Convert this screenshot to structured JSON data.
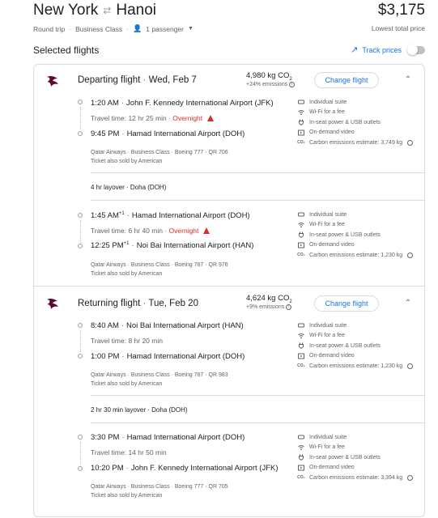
{
  "header": {
    "origin": "New York",
    "swap_icon": "swap-arrows-icon",
    "destination": "Hanoi",
    "total_price": "$3,175",
    "trip_type": "Round trip",
    "cabin": "Business Class",
    "passengers": "1 passenger",
    "price_note": "Lowest total price"
  },
  "selected": {
    "title": "Selected flights",
    "track_label": "Track prices",
    "track_enabled": false
  },
  "departing": {
    "heading": "Departing flight",
    "date": "Wed, Feb 7",
    "co2_value": "4,980 kg CO",
    "co2_sub": "2",
    "co2_note": "+24% emissions",
    "change_label": "Change flight",
    "legs": [
      {
        "dep_time": "1:20 AM",
        "dep_sup": "",
        "dep_airport": "John F. Kennedy International Airport (JFK)",
        "travel_time": "Travel time: 12 hr 25 min",
        "overnight": "Overnight",
        "arr_time": "9:45 PM",
        "arr_sup": "",
        "arr_airport": "Hamad International Airport (DOH)",
        "details": "Qatar Airways · Business Class · Boeing 777 · QR 706",
        "sold_by": "Ticket also sold by American",
        "amenities": [
          "Individual suite",
          "Wi-Fi for a fee",
          "In-seat power & USB outlets",
          "On-demand video",
          "Carbon emissions estimate: 3,749 kg"
        ]
      },
      {
        "dep_time": "1:45 AM",
        "dep_sup": "+1",
        "dep_airport": "Hamad International Airport (DOH)",
        "travel_time": "Travel time: 6 hr 40 min",
        "overnight": "Overnight",
        "arr_time": "12:25 PM",
        "arr_sup": "+1",
        "arr_airport": "Noi Bai International Airport (HAN)",
        "details": "Qatar Airways · Business Class · Boeing 787 · QR 976",
        "sold_by": "Ticket also sold by American",
        "amenities": [
          "Individual suite",
          "Wi-Fi for a fee",
          "In-seat power & USB outlets",
          "On-demand video",
          "Carbon emissions estimate: 1,230 kg"
        ]
      }
    ],
    "layover": "4 hr layover · Doha (DOH)"
  },
  "returning": {
    "heading": "Returning flight",
    "date": "Tue, Feb 20",
    "co2_value": "4,624 kg CO",
    "co2_sub": "2",
    "co2_note": "+9% emissions",
    "change_label": "Change flight",
    "legs": [
      {
        "dep_time": "8:40 AM",
        "dep_airport": "Noi Bai International Airport (HAN)",
        "travel_time": "Travel time: 8 hr 20 min",
        "arr_time": "1:00 PM",
        "arr_airport": "Hamad International Airport (DOH)",
        "details": "Qatar Airways · Business Class · Boeing 787 · QR 983",
        "sold_by": "Ticket also sold by American",
        "amenities": [
          "Individual suite",
          "Wi-Fi for a fee",
          "In-seat power & USB outlets",
          "On-demand video",
          "Carbon emissions estimate: 1,230 kg"
        ]
      },
      {
        "dep_time": "3:30 PM",
        "dep_airport": "Hamad International Airport (DOH)",
        "travel_time": "Travel time: 14 hr 50 min",
        "arr_time": "10:20 PM",
        "arr_airport": "John F. Kennedy International Airport (JFK)",
        "details": "Qatar Airways · Business Class · Boeing 777 · QR 705",
        "sold_by": "Ticket also sold by American",
        "amenities": [
          "Individual suite",
          "Wi-Fi for a fee",
          "In-seat power & USB outlets",
          "On-demand video",
          "Carbon emissions estimate: 3,394 kg"
        ]
      }
    ],
    "layover": "2 hr 30 min layover · Doha (DOH)"
  },
  "colors": {
    "accent": "#1a73e8",
    "warning": "#d93025",
    "airline": "#5c0632"
  }
}
